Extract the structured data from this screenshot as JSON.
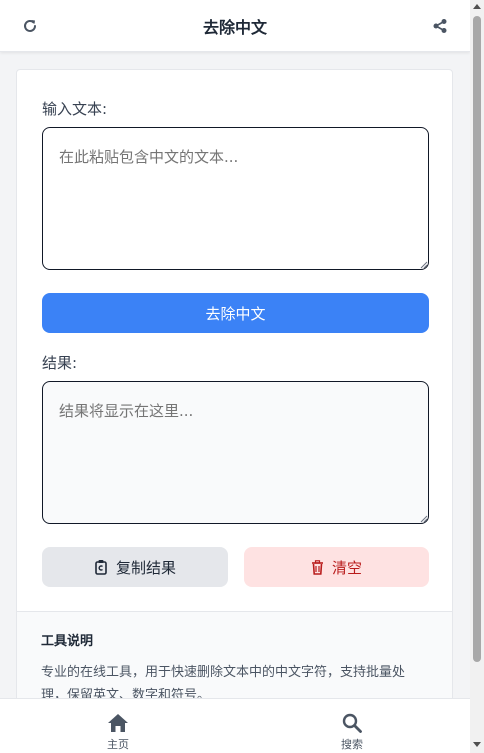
{
  "header": {
    "title": "去除中文"
  },
  "form": {
    "input_label": "输入文本:",
    "input_placeholder": "在此粘贴包含中文的文本...",
    "remove_button_label": "去除中文",
    "result_label": "结果:",
    "result_placeholder": "结果将显示在这里...",
    "copy_button_label": "复制结果",
    "clear_button_label": "清空"
  },
  "info": {
    "title": "工具说明",
    "text": "专业的在线工具，用于快速删除文本中的中文字符，支持批量处理，保留英文、数字和符号。"
  },
  "bottom_nav": {
    "items": [
      {
        "label": "主页",
        "icon": "home-icon"
      },
      {
        "label": "搜索",
        "icon": "search-icon"
      }
    ]
  },
  "colors": {
    "primary": "#3b82f6",
    "danger_bg": "#fee2e2",
    "danger_text": "#b91c1c",
    "neutral_bg": "#e5e7eb"
  }
}
